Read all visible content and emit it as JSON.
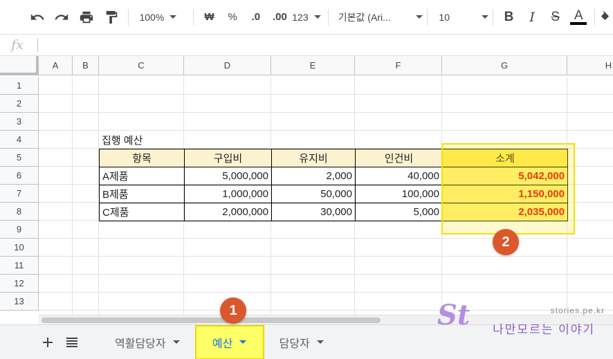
{
  "toolbar": {
    "zoom": "100%",
    "currency": "₩",
    "percent": "%",
    "dec_decrease": ".0",
    "dec_increase": ".00",
    "format_more": "123",
    "font": "기본값 (Ari...",
    "font_size": "10",
    "bold": "B",
    "italic": "I",
    "strike": "S",
    "text_color": "A"
  },
  "formula_bar": {
    "fx": "fx",
    "value": ""
  },
  "columns": [
    "A",
    "B",
    "C",
    "D",
    "E",
    "F",
    "G",
    "H"
  ],
  "rows": [
    "1",
    "2",
    "3",
    "4",
    "5",
    "6",
    "7",
    "8",
    "9",
    "10",
    "11",
    "12",
    "13"
  ],
  "sheet": {
    "title": "집행 예산",
    "headers": [
      "항목",
      "구입비",
      "유지비",
      "인건비",
      "소계"
    ],
    "data": [
      [
        "A제품",
        "5,000,000",
        "2,000",
        "40,000",
        "5,042,000"
      ],
      [
        "B제품",
        "1,000,000",
        "50,000",
        "100,000",
        "1,150,000"
      ],
      [
        "C제품",
        "2,000,000",
        "30,000",
        "5,000",
        "2,035,000"
      ]
    ]
  },
  "tabs": [
    "역활담당자",
    "예산",
    "담당자"
  ],
  "badges": [
    "1",
    "2"
  ],
  "watermark": {
    "url": "stories.pe.kr",
    "title": "나만모르는 이야기",
    "logo": "St"
  },
  "colors": {
    "header_fill": "#fdf2d0",
    "total_fill": "#ffef70",
    "total_text": "#e00000",
    "highlight": "#ffff66",
    "badge": "#d9582c",
    "active_tab_text": "#1a73e8"
  }
}
